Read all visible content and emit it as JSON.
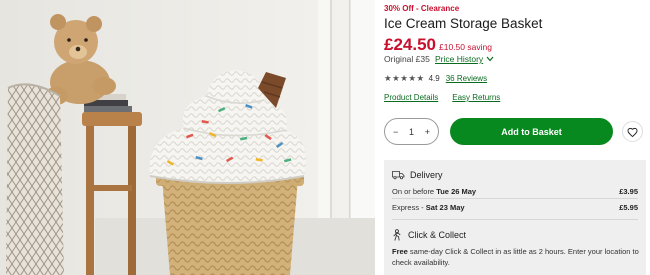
{
  "product": {
    "badge": "30% Off - Clearance",
    "title": "Ice Cream Storage Basket",
    "price": "£24.50",
    "saving": "£10.50 saving",
    "original_price": "Original £35",
    "price_history_label": "Price History",
    "stars": "★★★★★",
    "rating": "4.9",
    "reviews_label": "36 Reviews"
  },
  "links": {
    "product_details": "Product Details",
    "easy_returns": "Easy Returns"
  },
  "purchase": {
    "quantity": "1",
    "minus": "−",
    "plus": "+",
    "add_to_basket": "Add to Basket"
  },
  "delivery": {
    "heading": "Delivery",
    "options": [
      {
        "label_prefix": "On or before ",
        "label_date": "Tue 26 May",
        "price": "£3.95"
      },
      {
        "label_prefix": "Express - ",
        "label_date": "Sat 23 May",
        "price": "£5.95"
      }
    ]
  },
  "click_collect": {
    "heading": "Click & Collect",
    "text_bold": "Free",
    "text": " same-day Click & Collect in as little as 2 hours. Enter your location to check availability."
  },
  "colors": {
    "sale_red": "#c8102e",
    "accent_green": "#07891f",
    "link_green": "#0b6b20",
    "panel_grey": "#efefef"
  },
  "icons": [
    "chevron-down-icon",
    "heart-icon",
    "delivery-truck-icon",
    "click-collect-icon"
  ]
}
